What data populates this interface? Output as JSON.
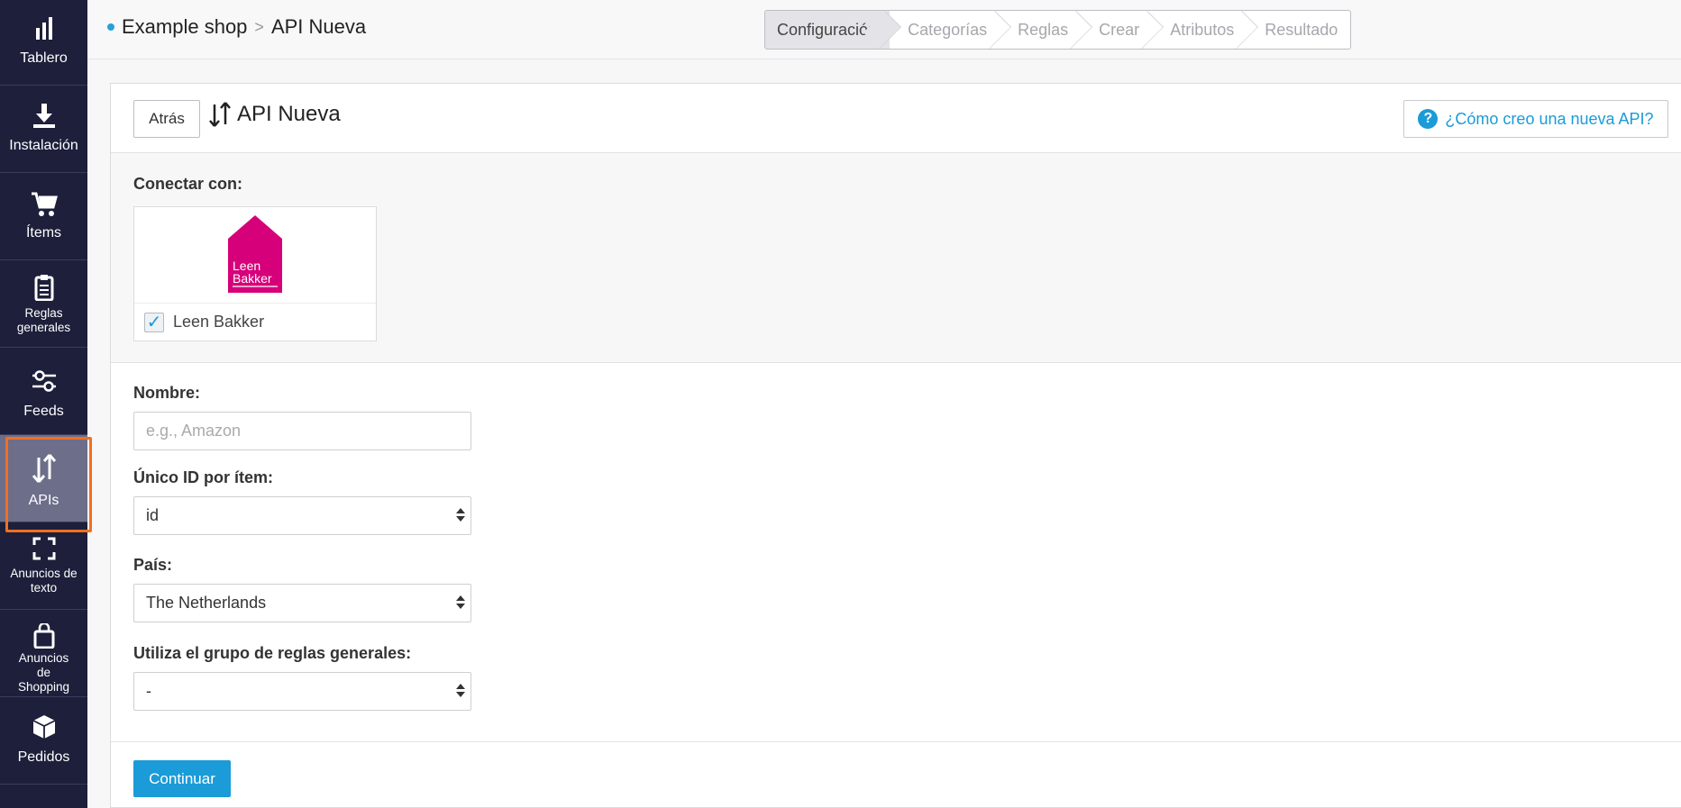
{
  "sidebar": {
    "items": [
      {
        "label": "Tablero",
        "icon": "bar-chart-icon"
      },
      {
        "label": "Instalación",
        "icon": "download-icon"
      },
      {
        "label": "Ítems",
        "icon": "cart-icon"
      },
      {
        "label": "Reglas generales",
        "icon": "clipboard-icon"
      },
      {
        "label": "Feeds",
        "icon": "sliders-icon"
      },
      {
        "label": "APIs",
        "icon": "sort-arrows-icon"
      },
      {
        "label": "Anuncios de texto",
        "icon": "frame-corners-icon"
      },
      {
        "label": "Anuncios de Shopping",
        "icon": "shopping-bag-icon"
      },
      {
        "label": "Pedidos",
        "icon": "box-icon"
      }
    ],
    "active": "APIs"
  },
  "breadcrumb": {
    "shop": "Example shop",
    "separator": ">",
    "page": "API Nueva"
  },
  "steps": [
    "Configuración",
    "Categorías",
    "Reglas",
    "Crear",
    "Atributos",
    "Resultado"
  ],
  "header": {
    "back_label": "Atrás",
    "title": "API Nueva",
    "help_label": "¿Cómo creo una nueva API?"
  },
  "connect": {
    "label": "Conectar con:",
    "partner": {
      "name": "Leen Bakker",
      "logo_line1": "Leen",
      "logo_line2": "Bakker",
      "checked": true
    }
  },
  "form": {
    "name": {
      "label": "Nombre:",
      "placeholder": "e.g., Amazon",
      "value": ""
    },
    "unique_id": {
      "label": "Único ID por ítem:",
      "value": "id"
    },
    "country": {
      "label": "País:",
      "value": "The Netherlands"
    },
    "rule_group": {
      "label": "Utiliza el grupo de reglas generales:",
      "value": "-"
    }
  },
  "continue_label": "Continuar",
  "colors": {
    "sidebar_bg": "#1d1f3b",
    "accent": "#1b9bd7",
    "active_outline": "#f26f21",
    "brand_magenta": "#d6007a"
  }
}
